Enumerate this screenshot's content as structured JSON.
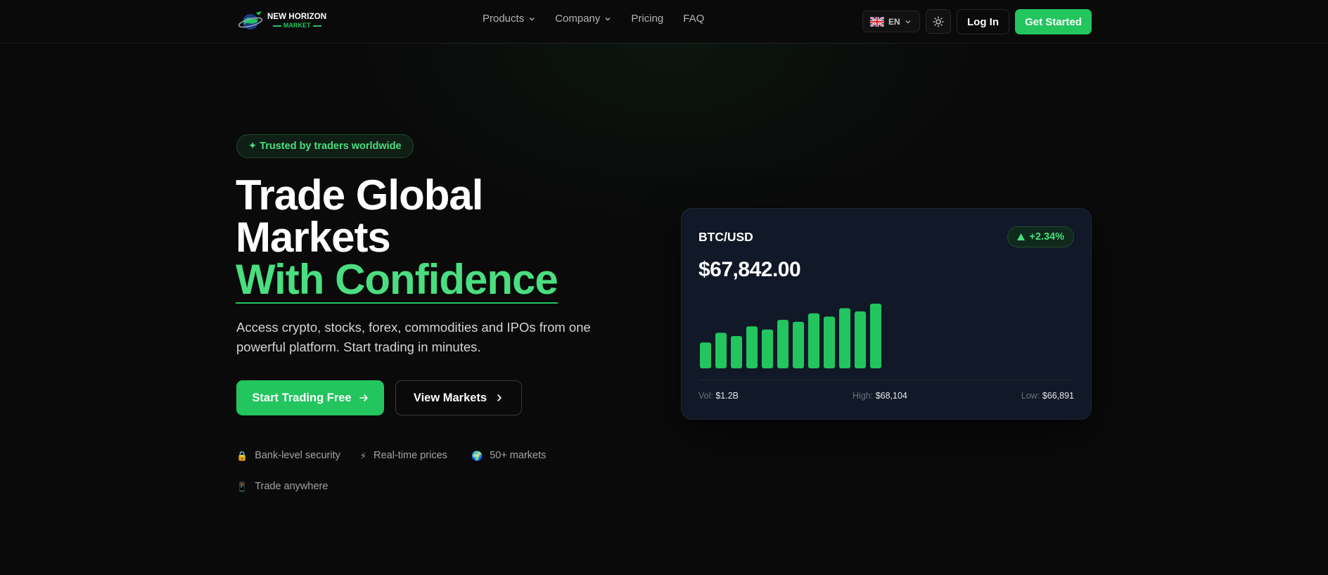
{
  "nav": {
    "logo_line1": "NEW HORIZON",
    "logo_line2": "MARKET",
    "links": [
      {
        "label": "Products",
        "dropdown": true
      },
      {
        "label": "Company",
        "dropdown": true
      },
      {
        "label": "Pricing",
        "dropdown": false
      },
      {
        "label": "FAQ",
        "dropdown": false
      }
    ],
    "language": "EN",
    "theme_icon": "sun-icon",
    "login_label": "Log In",
    "get_started_label": "Get Started"
  },
  "hero": {
    "badge": "✦ Trusted by traders worldwide",
    "title_line1": "Trade Global",
    "title_line2": "Markets",
    "title_line3": "With Confidence",
    "subtitle": "Access crypto, stocks, forex, commodities and IPOs from one powerful platform. Start trading in minutes.",
    "primary_cta": "Start Trading Free",
    "secondary_cta": "View Markets",
    "features": [
      {
        "icon": "🔒",
        "label": "Bank-level security"
      },
      {
        "icon": "⚡",
        "label": "Real-time prices"
      },
      {
        "icon": "🌍",
        "label": "50+ markets"
      },
      {
        "icon": "📱",
        "label": "Trade anywhere"
      }
    ]
  },
  "ticker_card": {
    "pair": "BTC/USD",
    "change": "+2.34%",
    "price": "$67,842.00",
    "bar_values": [
      4,
      5.5,
      5,
      6.5,
      6,
      7.5,
      7.2,
      8.5,
      8,
      9.3,
      8.8,
      10
    ],
    "volume_label": "Vol:",
    "volume": "$1.2B",
    "high_label": "High:",
    "high": "$68,104",
    "low_label": "Low:",
    "low": "$66,891"
  },
  "colors": {
    "accent": "#22c55e",
    "accent_text": "#4ade80",
    "background": "#0a0a0a",
    "card_bg": "#111827"
  }
}
